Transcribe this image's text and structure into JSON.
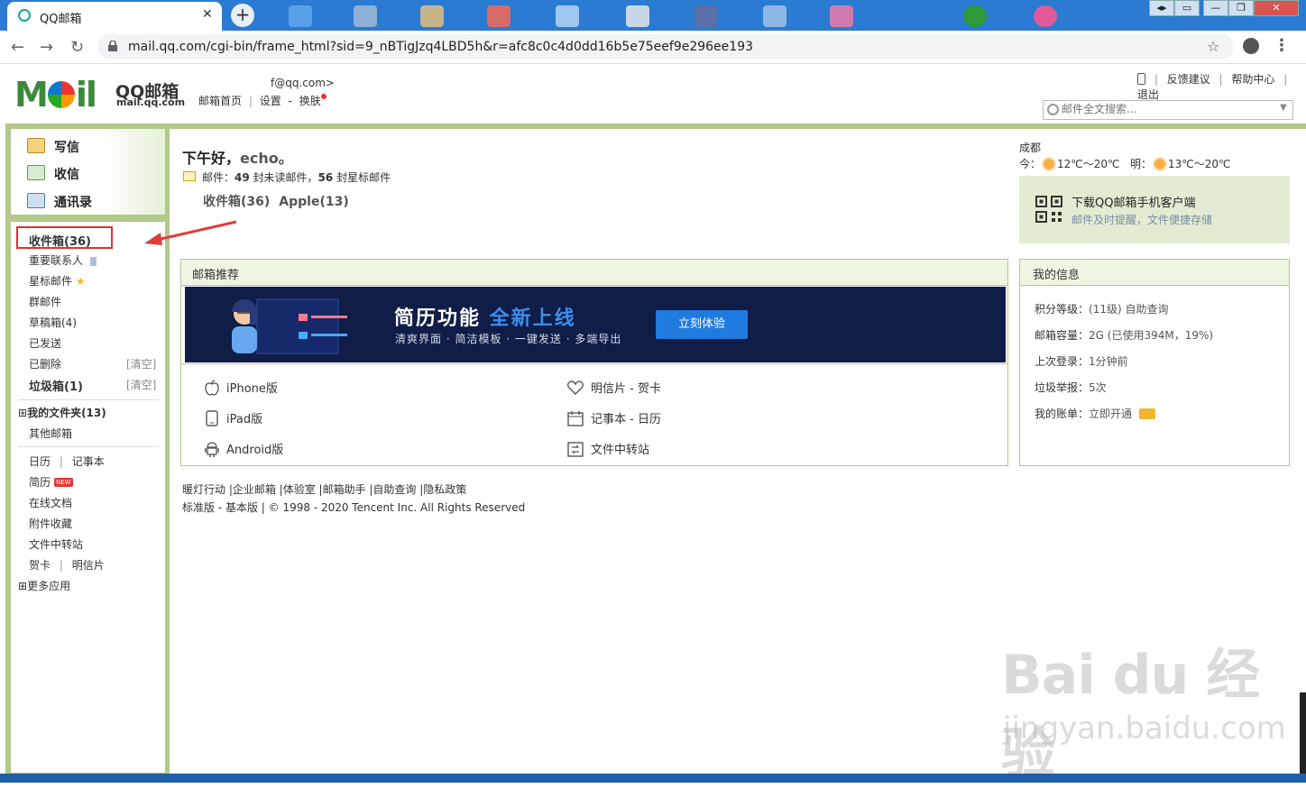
{
  "browser": {
    "tab_title": "QQ邮箱",
    "tab_close": "✕",
    "new_tab": "+",
    "url": "mail.qq.com/cgi-bin/frame_html?sid=9_nBTigJzq4LBD5h&r=afc8c0c4d0dd16b5e75eef9e296ee193",
    "back": "←",
    "forward": "→",
    "reload": "↻",
    "bookmark_star": "☆",
    "menu": "⋮"
  },
  "header": {
    "logo": "M",
    "logo_tail": "il",
    "logo_name": "QQ邮箱",
    "logo_domain": "mail.qq.com",
    "user_email": "f@qq.com>",
    "links": [
      "邮箱首页",
      "|",
      "设置",
      "-",
      "换肤"
    ],
    "top_links": [
      "|",
      "反馈建议",
      "|",
      "帮助中心",
      "|",
      "退出"
    ],
    "search_placeholder": "邮件全文搜索..."
  },
  "sidebar": {
    "compose": "写信",
    "receive": "收信",
    "contacts": "通讯录",
    "inbox": "收件箱(36)",
    "important": "重要联系人",
    "starred": "星标邮件",
    "group": "群邮件",
    "drafts": "草稿箱(4)",
    "sent": "已发送",
    "deleted": "已删除",
    "deleted_clear": "[清空]",
    "spam": "垃圾箱(1)",
    "spam_clear": "[清空]",
    "my_folders": "我的文件夹(13)",
    "other_mail": "其他邮箱",
    "calendar": "日历",
    "calendar_sep": "|",
    "notes": "记事本",
    "resume": "简历",
    "resume_tag": "NEW",
    "docs": "在线文档",
    "attachments": "附件收藏",
    "file_transfer": "文件中转站",
    "cards": "贺卡",
    "cards_sep": "|",
    "postcards": "明信片",
    "more_apps": "更多应用",
    "expand": "⊞"
  },
  "main": {
    "greeting": "下午好，",
    "greeting_name": "echo。",
    "mail_label": "邮件：",
    "unread_count": "49",
    "unread_label": " 封未读邮件，",
    "star_count": "56",
    "star_label": " 封星标邮件",
    "quick_inbox": "收件箱(36)",
    "quick_apple": "Apple(13)",
    "city": "成都",
    "weather_today_label": "今：",
    "weather_today": "12℃～20℃",
    "weather_tomorrow_label": "明：",
    "weather_tomorrow": "13℃～20℃",
    "download_title": "下载QQ邮箱手机客户端",
    "download_sub": "邮件及时提醒，文件便捷存储"
  },
  "recommend": {
    "title": "邮箱推荐",
    "banner_title": "简历功能 ",
    "banner_highlight": "全新上线",
    "banner_sub": "清爽界面 · 简洁模板 · 一键发送 · 多端导出",
    "banner_button": "立刻体验",
    "apps_left": [
      "iPhone版",
      "iPad版",
      "Android版"
    ],
    "apps_right": [
      "明信片 - 贺卡",
      "记事本 - 日历",
      "文件中转站"
    ]
  },
  "info": {
    "title": "我的信息",
    "rows": [
      {
        "label": "积分等级：",
        "value": "(11级)  自助查询"
      },
      {
        "label": "邮箱容量：",
        "value": "2G (已使用394M，19%)"
      },
      {
        "label": "上次登录：",
        "value": "1分钟前"
      },
      {
        "label": "垃圾举报：",
        "value": "5次"
      },
      {
        "label": "我的账单：",
        "value": "立即开通"
      }
    ]
  },
  "footer": {
    "links": "暖灯行动 |企业邮箱 |体验室 |邮箱助手 |自助查询 |隐私政策",
    "copyright": "标准版 - 基本版 | © 1998 - 2020 Tencent Inc. All Rights Reserved"
  },
  "watermark": {
    "brand": "Bai  du 经验",
    "url": "jingyan.baidu.com"
  },
  "colors": {
    "chrome_blue": "#2a7bd1",
    "frame_green": "#b2c98a",
    "banner_navy": "#0f1d47",
    "accent_blue": "#1f7be0",
    "highlight_red": "#d33"
  }
}
